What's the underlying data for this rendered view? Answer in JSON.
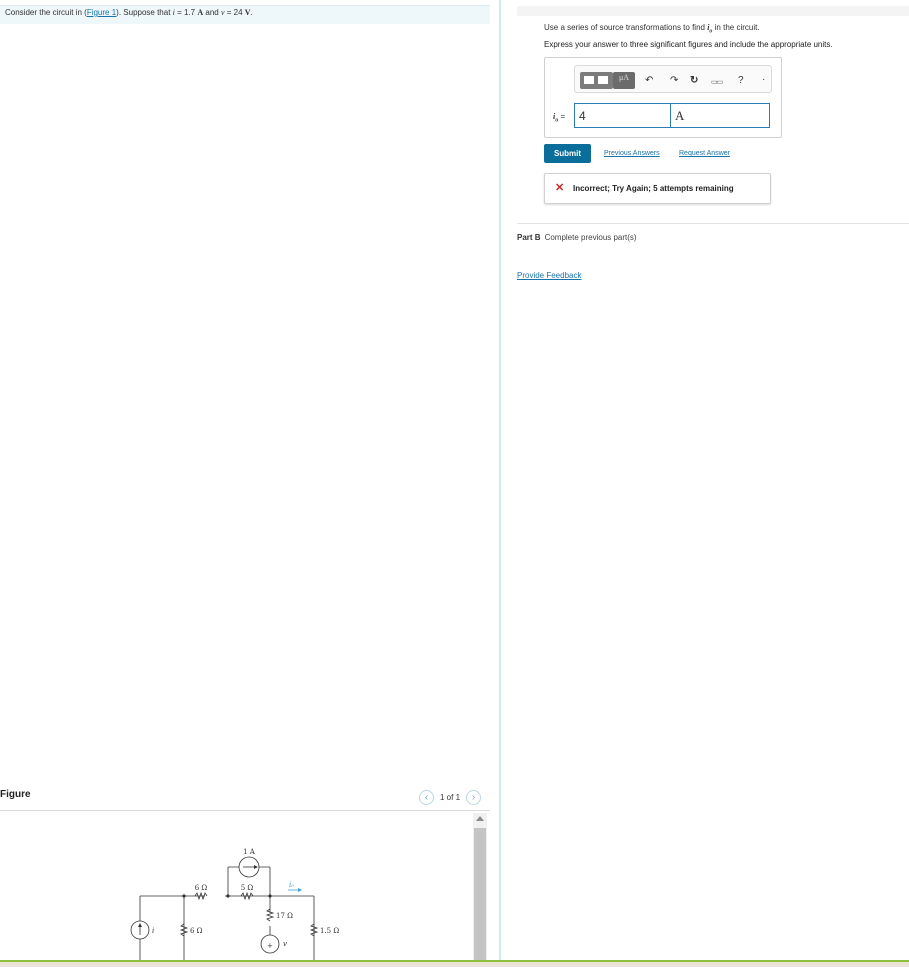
{
  "problem": {
    "prefix": "Consider the circuit in (",
    "link": "Figure 1",
    "middle": "). Suppose that ",
    "i_var": "i",
    "i_eq": " = 1.7 ",
    "i_unit": "A",
    "and": " and ",
    "v_var": "v",
    "v_eq": " = 24 ",
    "v_unit": "V",
    "suffix": "."
  },
  "figure": {
    "label": "Figure",
    "pager_text": "1 of 1",
    "prev_icon": "‹",
    "next_icon": "›",
    "circuit": {
      "source_1A": "1 A",
      "r_6_top": "6 Ω",
      "r_5": "5 Ω",
      "r_6_left": "6 Ω",
      "r_17": "17 Ω",
      "r_1_5": "1.5 Ω",
      "i_label": "i",
      "v_label": "v",
      "io_label": "i₀",
      "plus": "+"
    }
  },
  "question": {
    "line1_pre": "Use a series of source transformations to find ",
    "line1_var": "i",
    "line1_sub": "o",
    "line1_post": " in the circuit.",
    "line2": "Express your answer to three significant figures and include the appropriate units."
  },
  "toolbar": {
    "units_label": "μA",
    "undo_icon": "↶",
    "redo_icon": "↷",
    "reset_icon": "↻",
    "keyboard_icon": "▭▭",
    "help_icon": "?",
    "more_icon": "·"
  },
  "answer": {
    "var": "i",
    "sub": "o",
    "equals": " =",
    "value": "4",
    "unit": "A"
  },
  "actions": {
    "submit": "Submit",
    "previous_answers": "Previous Answers",
    "request_answer": "Request Answer"
  },
  "feedback": {
    "icon": "✕",
    "message": "Incorrect; Try Again; 5 attempts remaining"
  },
  "part_b": {
    "label": "Part B",
    "status": "Complete previous part(s)"
  },
  "provide_feedback": "Provide Feedback",
  "colors": {
    "accent": "#0b6e9a",
    "link": "#1a73a8",
    "error": "#c62828",
    "bottom_bar": "#8fbf3f"
  }
}
